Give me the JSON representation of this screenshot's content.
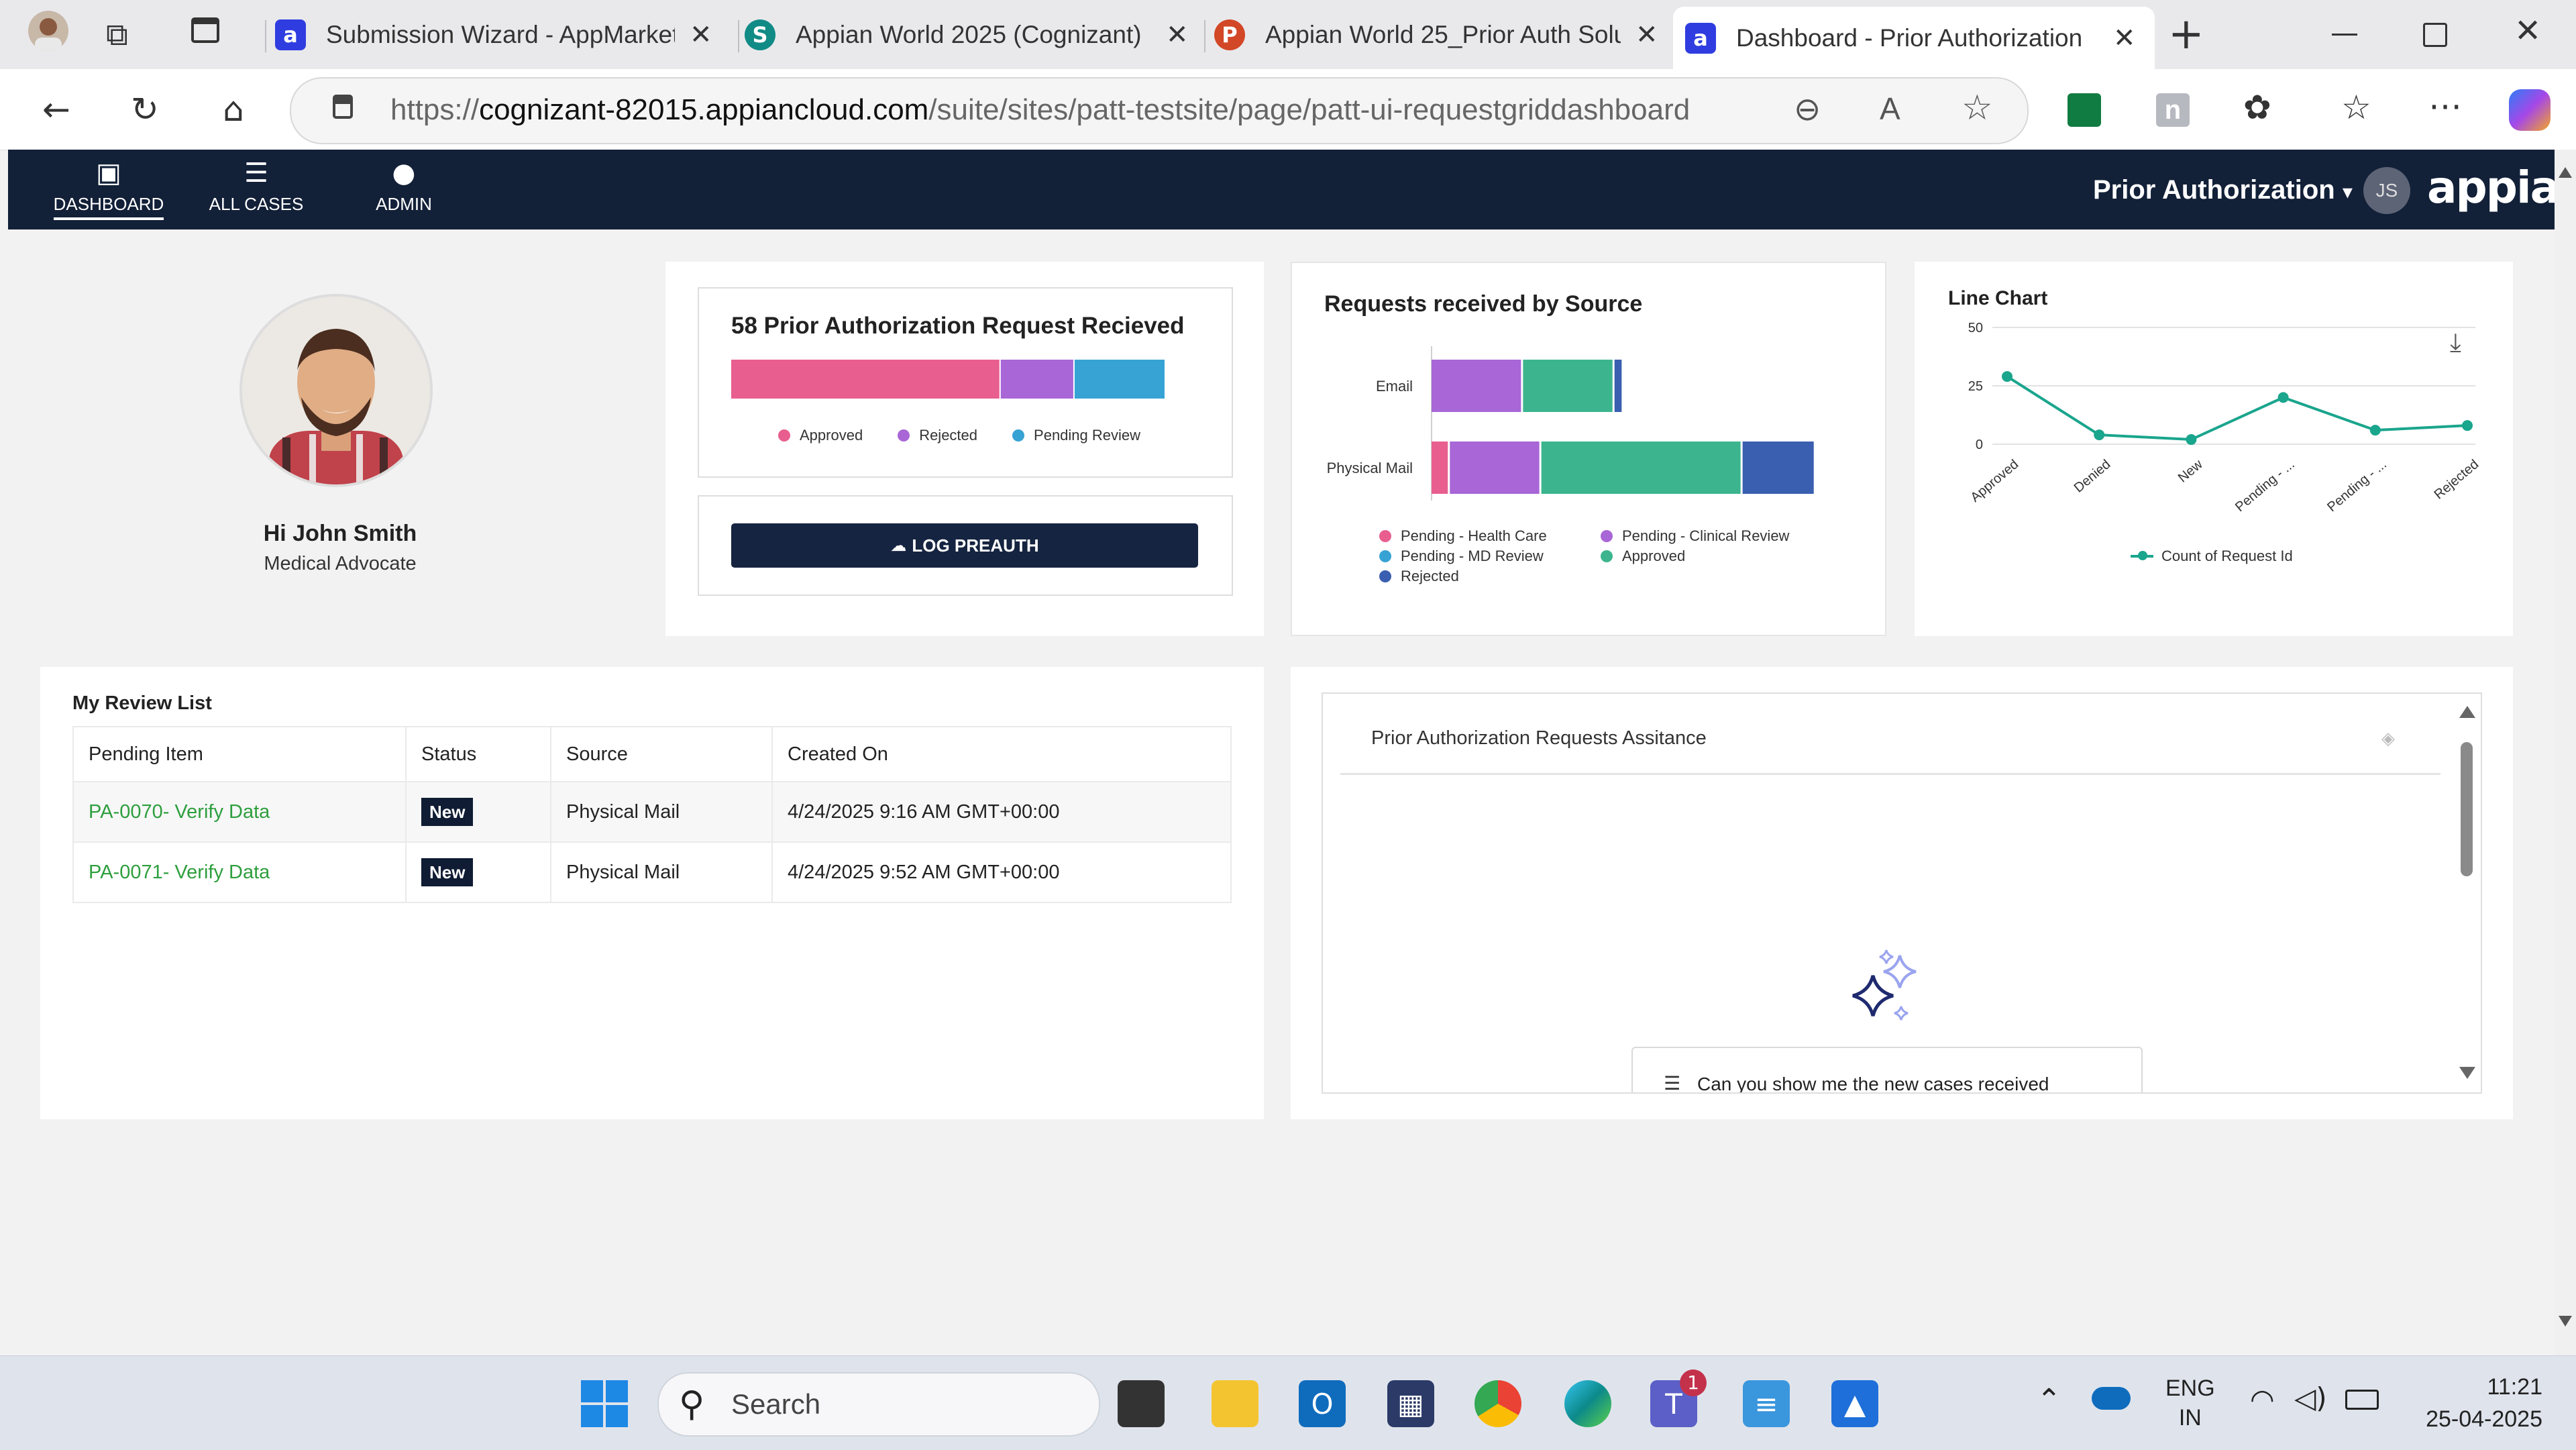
{
  "browser": {
    "tabs": [
      {
        "label": "Submission Wizard - AppMarket",
        "icon": "appian-a-icon",
        "active": false
      },
      {
        "label": "Appian World 2025 (Cognizant)",
        "icon": "sharepoint-icon",
        "active": false
      },
      {
        "label": "Appian World 25_Prior Auth Solu",
        "icon": "powerpoint-icon",
        "active": false
      },
      {
        "label": "Dashboard - Prior Authorization",
        "icon": "appian-a-icon",
        "active": true
      }
    ],
    "url_prefix": "https://",
    "url_host": "cognizant-82015.appiancloud.com",
    "url_path": "/suite/sites/patt-testsite/page/patt-ui-requestgriddashboard",
    "new_tab_symbol": "+"
  },
  "header": {
    "nav": [
      {
        "label": "DASHBOARD",
        "icon": "dashboard-icon",
        "active": true
      },
      {
        "label": "ALL CASES",
        "icon": "list-icon",
        "active": false
      },
      {
        "label": "ADMIN",
        "icon": "admin-user-icon",
        "active": false
      }
    ],
    "site_name": "Prior Authorization",
    "site_caret": "▾",
    "user_initials": "JS",
    "brand": "appian"
  },
  "profile": {
    "greeting": "Hi John Smith",
    "role": "Medical Advocate"
  },
  "summary": {
    "title": "58 Prior Authorization Request Recieved",
    "bar_segments": [
      {
        "label": "Approved",
        "fraction": 0.62,
        "color": "#e85f8f"
      },
      {
        "label": "Rejected",
        "fraction": 0.17,
        "color": "#a866d6"
      },
      {
        "label": "Pending Review",
        "fraction": 0.21,
        "color": "#37a3d4"
      }
    ],
    "log_button": "LOG PREAUTH"
  },
  "source_chart": {
    "title": "Requests received by Source",
    "colors": {
      "Pending - Health Care": "#e85f8f",
      "Pending - Clinical Review": "#a866d6",
      "Pending - MD Review": "#37a3d4",
      "Approved": "#3cb58e",
      "Rejected": "#3a5fb0"
    }
  },
  "line_chart": {
    "title": "Line Chart",
    "legend": "Count of Request Id",
    "color": "#1aa58d"
  },
  "chart_data": [
    {
      "type": "bar",
      "orientation": "horizontal",
      "stacked": true,
      "title": "Requests received by Source",
      "categories": [
        "Email",
        "Physical Mail"
      ],
      "series": [
        {
          "name": "Pending - Health Care",
          "values": [
            0,
            1
          ]
        },
        {
          "name": "Pending - Clinical Review",
          "values": [
            5,
            5
          ]
        },
        {
          "name": "Approved",
          "values": [
            5,
            11
          ]
        },
        {
          "name": "Pending - MD Review",
          "values": [
            0,
            0
          ]
        },
        {
          "name": "Rejected",
          "values": [
            0.5,
            4
          ]
        }
      ],
      "xlim": [
        0,
        22
      ],
      "legend": "bottom"
    },
    {
      "type": "line",
      "title": "Line Chart",
      "categories": [
        "Approved",
        "Denied",
        "New",
        "Pending - ...",
        "Pending - ...",
        "Rejected"
      ],
      "series": [
        {
          "name": "Count of Request Id",
          "values": [
            29,
            4,
            2,
            20,
            6,
            8
          ]
        }
      ],
      "yticks": [
        "50",
        "25",
        "0"
      ],
      "ylim": [
        0,
        50
      ],
      "grid": true,
      "legend": "bottom"
    }
  ],
  "review_list": {
    "title": "My Review List",
    "columns": [
      "Pending Item",
      "Status",
      "Source",
      "Created On"
    ],
    "rows": [
      {
        "item": "PA-0070- Verify Data",
        "status": "New",
        "source": "Physical Mail",
        "created": "4/24/2025 9:16 AM GMT+00:00"
      },
      {
        "item": "PA-0071- Verify Data",
        "status": "New",
        "source": "Physical Mail",
        "created": "4/24/2025 9:52 AM GMT+00:00"
      }
    ]
  },
  "assistant": {
    "title": "Prior Authorization Requests Assitance",
    "suggestion": "Can you show me the new cases received"
  },
  "taskbar": {
    "search_placeholder": "Search",
    "lang_line1": "ENG",
    "lang_line2": "IN",
    "time": "11:21",
    "date": "25-04-2025",
    "teams_badge": "1"
  }
}
